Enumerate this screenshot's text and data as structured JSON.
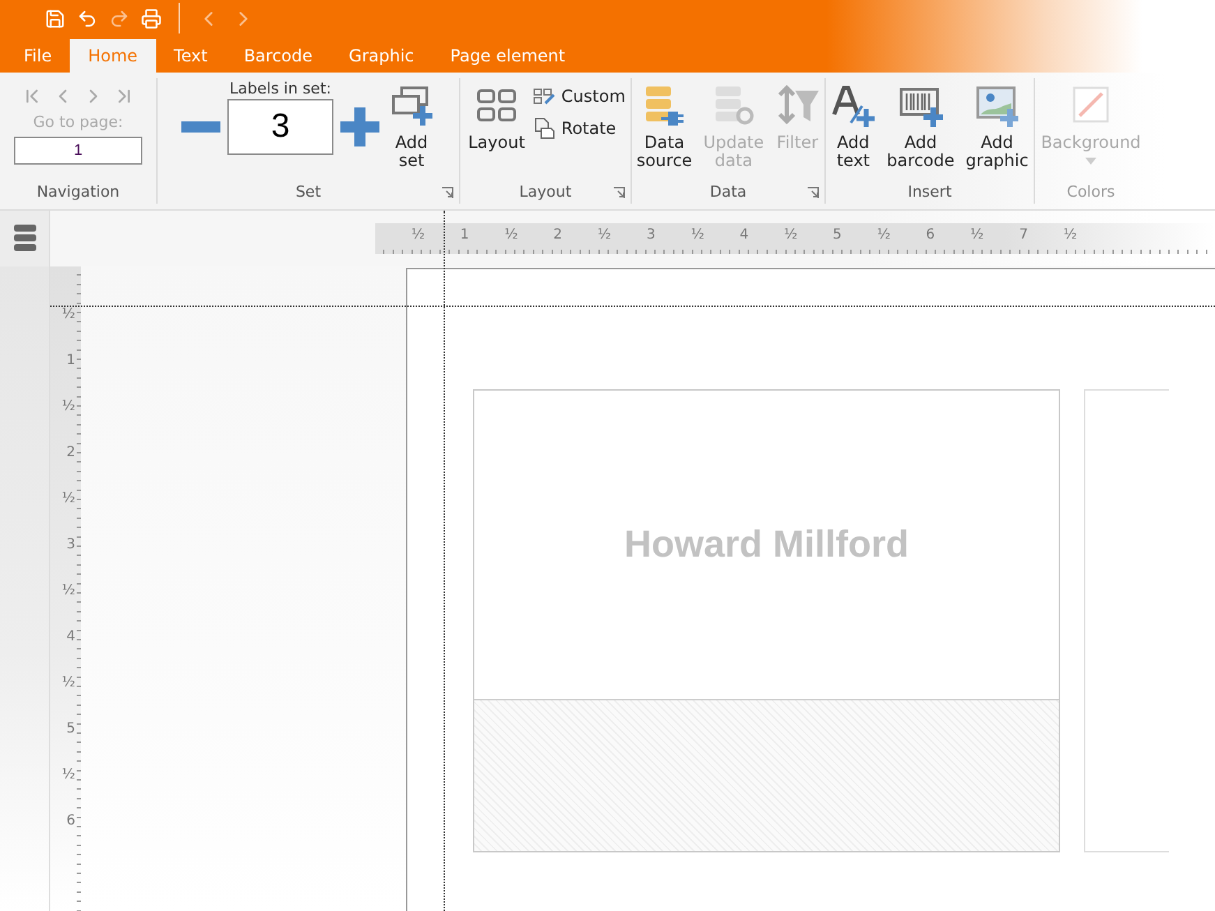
{
  "quick_access": [
    {
      "kind": "save",
      "disabled": false
    },
    {
      "kind": "undo",
      "disabled": false
    },
    {
      "kind": "redo",
      "disabled": true
    },
    {
      "kind": "print",
      "disabled": false
    }
  ],
  "history": [
    {
      "kind": "back",
      "disabled": true
    },
    {
      "kind": "forward",
      "disabled": true
    }
  ],
  "tabs": [
    {
      "label": "File",
      "selected": false
    },
    {
      "label": "Home",
      "selected": true
    },
    {
      "label": "Text",
      "selected": false
    },
    {
      "label": "Barcode",
      "selected": false
    },
    {
      "label": "Graphic",
      "selected": false
    },
    {
      "label": "Page element",
      "selected": false
    }
  ],
  "ribbon": {
    "navigation": {
      "title": "Navigation",
      "buttons": [
        {
          "kind": "first",
          "disabled": true
        },
        {
          "kind": "previous",
          "disabled": true
        },
        {
          "kind": "next",
          "disabled": true
        },
        {
          "kind": "last",
          "disabled": true
        }
      ],
      "go_to_label": "Go to page:",
      "page_value": "1"
    },
    "set": {
      "title": "Set",
      "count_label": "Labels in set:",
      "count_value": "3",
      "command": {
        "kind": "add-set",
        "label": "Add set",
        "disabled": false
      }
    },
    "layout": {
      "title": "Layout",
      "command": {
        "kind": "layout",
        "label": "Layout",
        "disabled": false
      },
      "small_commands": [
        {
          "kind": "custom",
          "label": "Custom"
        },
        {
          "kind": "rotate",
          "label": "Rotate"
        }
      ]
    },
    "data": {
      "title": "Data",
      "commands": [
        {
          "kind": "data-source",
          "label": "Data source",
          "disabled": false
        },
        {
          "kind": "update-data",
          "label": "Update data",
          "disabled": true
        },
        {
          "kind": "filter",
          "label": "Filter",
          "disabled": true
        }
      ]
    },
    "insert": {
      "title": "Insert",
      "commands": [
        {
          "kind": "add-text",
          "label": "Add text",
          "disabled": false
        },
        {
          "kind": "add-barcode",
          "label": "Add barcode",
          "disabled": false
        },
        {
          "kind": "add-graphic",
          "label": "Add graphic",
          "disabled": false
        }
      ]
    },
    "colors": {
      "title": "Colors",
      "command": {
        "kind": "background",
        "label": "Background",
        "disabled": true
      }
    }
  },
  "rulers": {
    "horizontal": [
      "½",
      "1",
      "½",
      "2",
      "½",
      "3",
      "½",
      "4",
      "½",
      "5",
      "½",
      "6",
      "½",
      "7",
      "½"
    ],
    "vertical": [
      "½",
      "1",
      "½",
      "2",
      "½",
      "3",
      "½",
      "4",
      "½",
      "5",
      "½",
      "6"
    ]
  },
  "label": {
    "text": "Howard Millford"
  }
}
